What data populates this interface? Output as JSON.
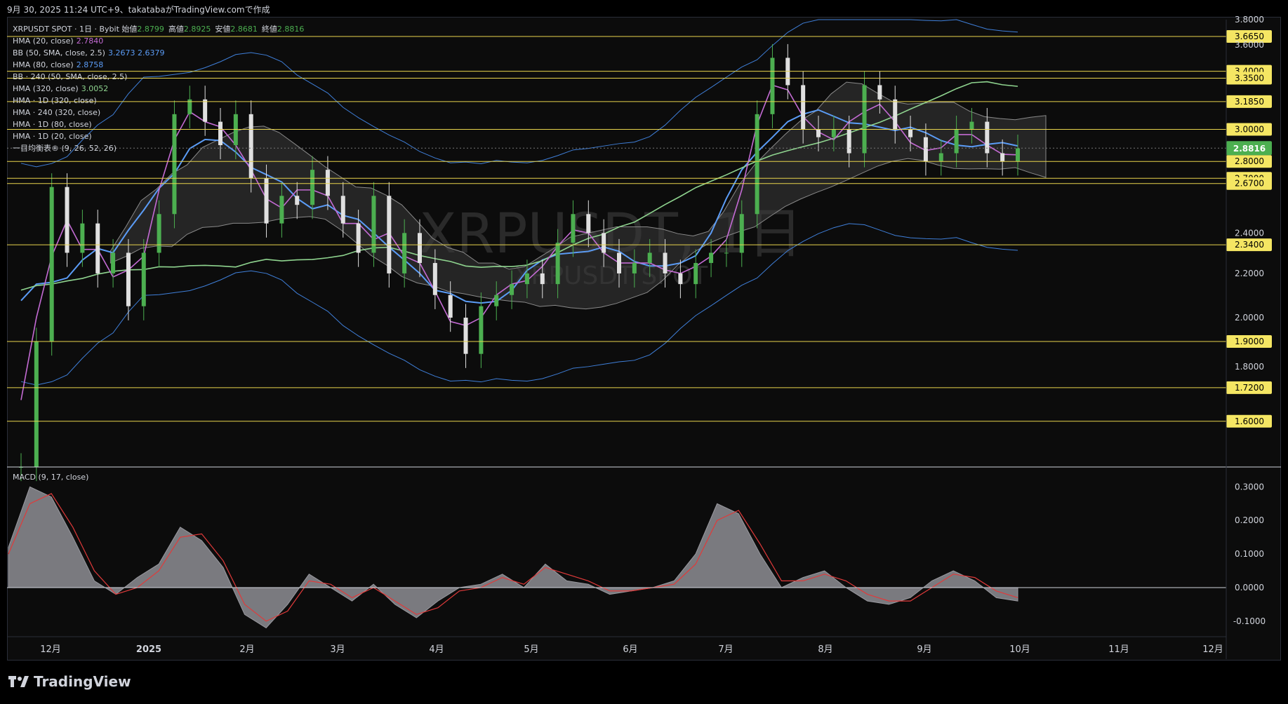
{
  "header": {
    "text": "9月 30, 2025 11:24 UTC+9、takatabaがTradingView.comで作成"
  },
  "legend": [
    {
      "label": "XRPUSDT SPOT · 1日 · Bybit  始値",
      "value": "2.8799",
      "label2": "高値",
      "value2": "2.8925",
      "label3": "安値",
      "value3": "2.8681",
      "label4": "終値",
      "value4": "2.8816"
    },
    {
      "label": "HMA (20, close)",
      "value": "2.7840",
      "color": "#c46bd4"
    },
    {
      "label": "BB (50, SMA, close, 2.5)",
      "value": "3.2673  2.6379",
      "color": "#5b9cf6"
    },
    {
      "label": "HMA (80, close)",
      "value": "2.8758",
      "color": "#5b9cf6"
    },
    {
      "label": "BB · 240 (50, SMA, close, 2.5)",
      "value": "",
      "color": ""
    },
    {
      "label": "HMA (320, close)",
      "value": "3.0052",
      "color": "#8fd48f"
    },
    {
      "label": "HMA · 1D (320, close)",
      "value": "",
      "color": ""
    },
    {
      "label": "HMA · 240 (320, close)",
      "value": "",
      "color": ""
    },
    {
      "label": "HMA · 1D (80, close)",
      "value": "",
      "color": ""
    },
    {
      "label": "HMA · 1D (20, close)",
      "value": "",
      "color": ""
    },
    {
      "label": "一目均衡表® (9, 26, 52, 26)",
      "value": "",
      "color": ""
    }
  ],
  "macd_label": "MACD (9, 17, close)",
  "watermark": {
    "main": "XRPUSDT, 1日",
    "sub": "XRPUSDT SPOT"
  },
  "footer": {
    "brand": "TradingView"
  },
  "colors": {
    "up": "#4caf50",
    "down": "#e0e0e0",
    "hline": "#e8d44d",
    "hma20": "#c46bd4",
    "bb": "#3f7fd9",
    "hma80": "#5b9cf6",
    "hma320": "#8fd48f",
    "signal": "#e03a3a",
    "last": "#4caf50"
  },
  "chart_data": [
    {
      "type": "line",
      "title": "XRPUSDT SPOT · 1日 · Bybit",
      "x_labels": [
        "12月",
        "2025",
        "2月",
        "3月",
        "4月",
        "5月",
        "6月",
        "7月",
        "8月",
        "9月",
        "10月",
        "11月",
        "12月"
      ],
      "y_ticks": [
        "3.8000",
        "3.6000",
        "2.4000",
        "2.2000",
        "2.0000",
        "1.8000"
      ],
      "ylim": [
        1.45,
        3.8
      ],
      "log_scale": true,
      "horizontal_levels": [
        "3.6650",
        "3.4000",
        "3.3500",
        "3.1850",
        "3.0000",
        "2.8000",
        "2.7000",
        "2.6700",
        "2.3400",
        "1.9000",
        "1.7200",
        "1.6000"
      ],
      "last_price": "2.8816",
      "ohlc_last": {
        "open": 2.8799,
        "high": 2.8925,
        "low": 2.8681,
        "close": 2.8816
      },
      "close_series": [
        1.45,
        1.9,
        2.65,
        2.3,
        2.45,
        2.2,
        2.3,
        2.05,
        2.3,
        2.5,
        3.1,
        3.2,
        3.05,
        2.9,
        3.1,
        2.7,
        2.45,
        2.6,
        2.55,
        2.75,
        2.6,
        2.45,
        2.3,
        2.6,
        2.2,
        2.4,
        2.25,
        2.1,
        2.0,
        1.85,
        2.05,
        2.1,
        2.15,
        2.2,
        2.15,
        2.35,
        2.5,
        2.4,
        2.3,
        2.2,
        2.25,
        2.3,
        2.2,
        2.15,
        2.25,
        2.3,
        2.3,
        2.5,
        3.1,
        3.5,
        3.3,
        3.0,
        2.95,
        3.0,
        2.85,
        3.3,
        3.2,
        3.0,
        2.95,
        2.8,
        2.85,
        3.0,
        3.05,
        2.85,
        2.8,
        2.88
      ],
      "series": [
        {
          "name": "HMA (20, close)",
          "last": 2.784
        },
        {
          "name": "BB (50, SMA, close, 2.5)",
          "last": "3.2673 / 2.6379"
        },
        {
          "name": "HMA (80, close)",
          "last": 2.8758
        },
        {
          "name": "HMA (320, close)",
          "last": 3.0052
        }
      ]
    },
    {
      "type": "area",
      "title": "MACD (9, 17, close)",
      "y_ticks": [
        "0.3000",
        "0.2000",
        "0.1000",
        "0.0000",
        "-0.1000"
      ],
      "ylim": [
        -0.14,
        0.33
      ],
      "macd": [
        0.12,
        0.3,
        0.27,
        0.15,
        0.02,
        -0.02,
        0.03,
        0.07,
        0.18,
        0.14,
        0.06,
        -0.08,
        -0.12,
        -0.05,
        0.04,
        0.0,
        -0.04,
        0.01,
        -0.05,
        -0.09,
        -0.04,
        0.0,
        0.01,
        0.04,
        0.0,
        0.07,
        0.02,
        0.01,
        -0.02,
        -0.01,
        0.0,
        0.02,
        0.1,
        0.25,
        0.22,
        0.1,
        0.0,
        0.03,
        0.05,
        0.0,
        -0.04,
        -0.05,
        -0.03,
        0.02,
        0.05,
        0.02,
        -0.03,
        -0.04
      ],
      "signal": [
        0.1,
        0.25,
        0.28,
        0.18,
        0.05,
        -0.02,
        0.0,
        0.05,
        0.15,
        0.16,
        0.08,
        -0.05,
        -0.1,
        -0.07,
        0.02,
        0.01,
        -0.03,
        0.0,
        -0.04,
        -0.08,
        -0.06,
        -0.01,
        0.0,
        0.03,
        0.01,
        0.06,
        0.04,
        0.02,
        -0.01,
        -0.01,
        0.0,
        0.01,
        0.07,
        0.2,
        0.23,
        0.13,
        0.02,
        0.02,
        0.04,
        0.02,
        -0.02,
        -0.04,
        -0.04,
        0.0,
        0.04,
        0.03,
        -0.01,
        -0.03
      ]
    }
  ]
}
